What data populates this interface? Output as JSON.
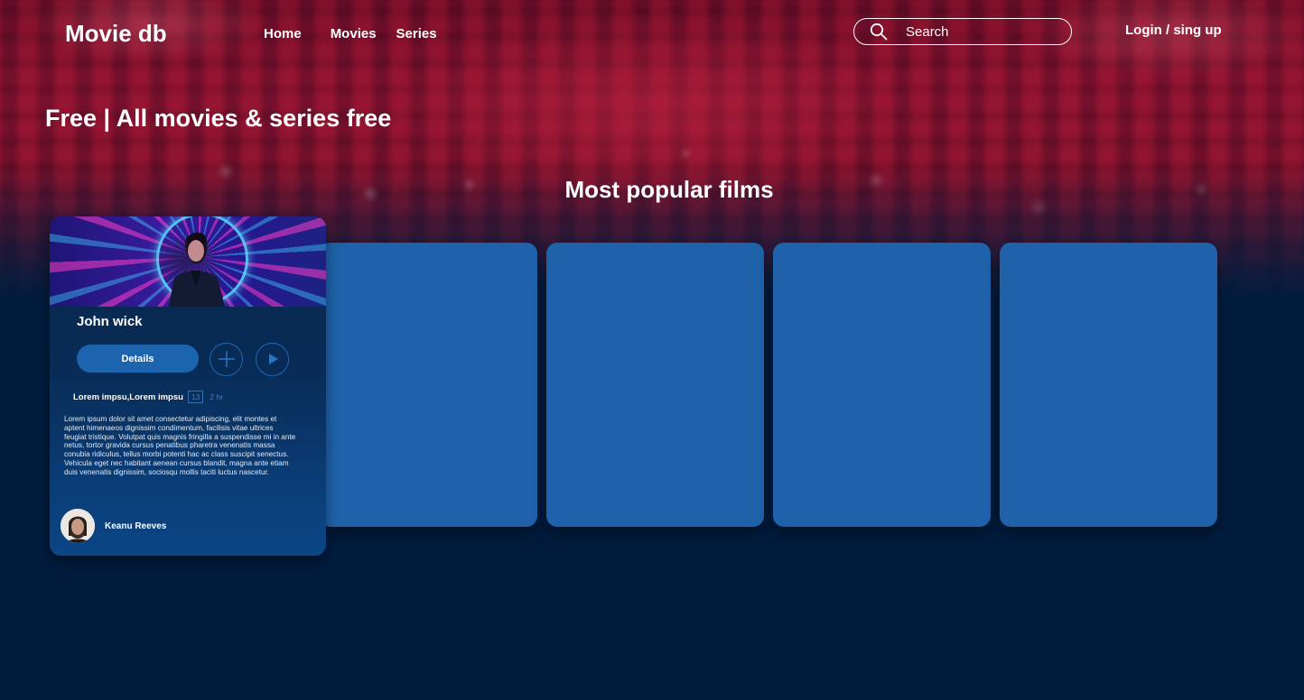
{
  "header": {
    "logo": "Movie db",
    "nav": [
      "Home",
      "Movies",
      "Series"
    ],
    "search_placeholder": "Search",
    "login": "Login / sing up"
  },
  "hero": {
    "tagline": "Free | All movies & series free"
  },
  "section": {
    "title": "Most popular films"
  },
  "featured": {
    "title": "John wick",
    "details_label": "Details",
    "genres": "Lorem impsu,Lorem impsu",
    "rating": "13",
    "duration": "2 hr",
    "description": "Lorem ipsum dolor sit amet consectetur adipiscing, elit montes et aptent himenaeos dignissim condimentum, facilisis vitae ultrices feugiat tristique. Volutpat quis magnis fringilla a suspendisse mi in ante netus, tortor gravida cursus penatibus pharetra venenatis massa conubia ridiculus, tellus morbi potenti hac ac class suscipit senectus. Vehicula eget nec habitant aenean cursus blandit, magna ante etiam duis venenatis dignissim, sociosqu mollis taciti luctus nascetur.",
    "actor": "Keanu Reeves"
  },
  "colors": {
    "background": "#011c3d",
    "card": "#1f62a9",
    "button": "#1d64ae",
    "accent_outline": "#1f68b8"
  },
  "icons": {
    "search": "search-icon",
    "add": "plus-icon",
    "play": "play-icon"
  },
  "placeholder_cards": 4
}
